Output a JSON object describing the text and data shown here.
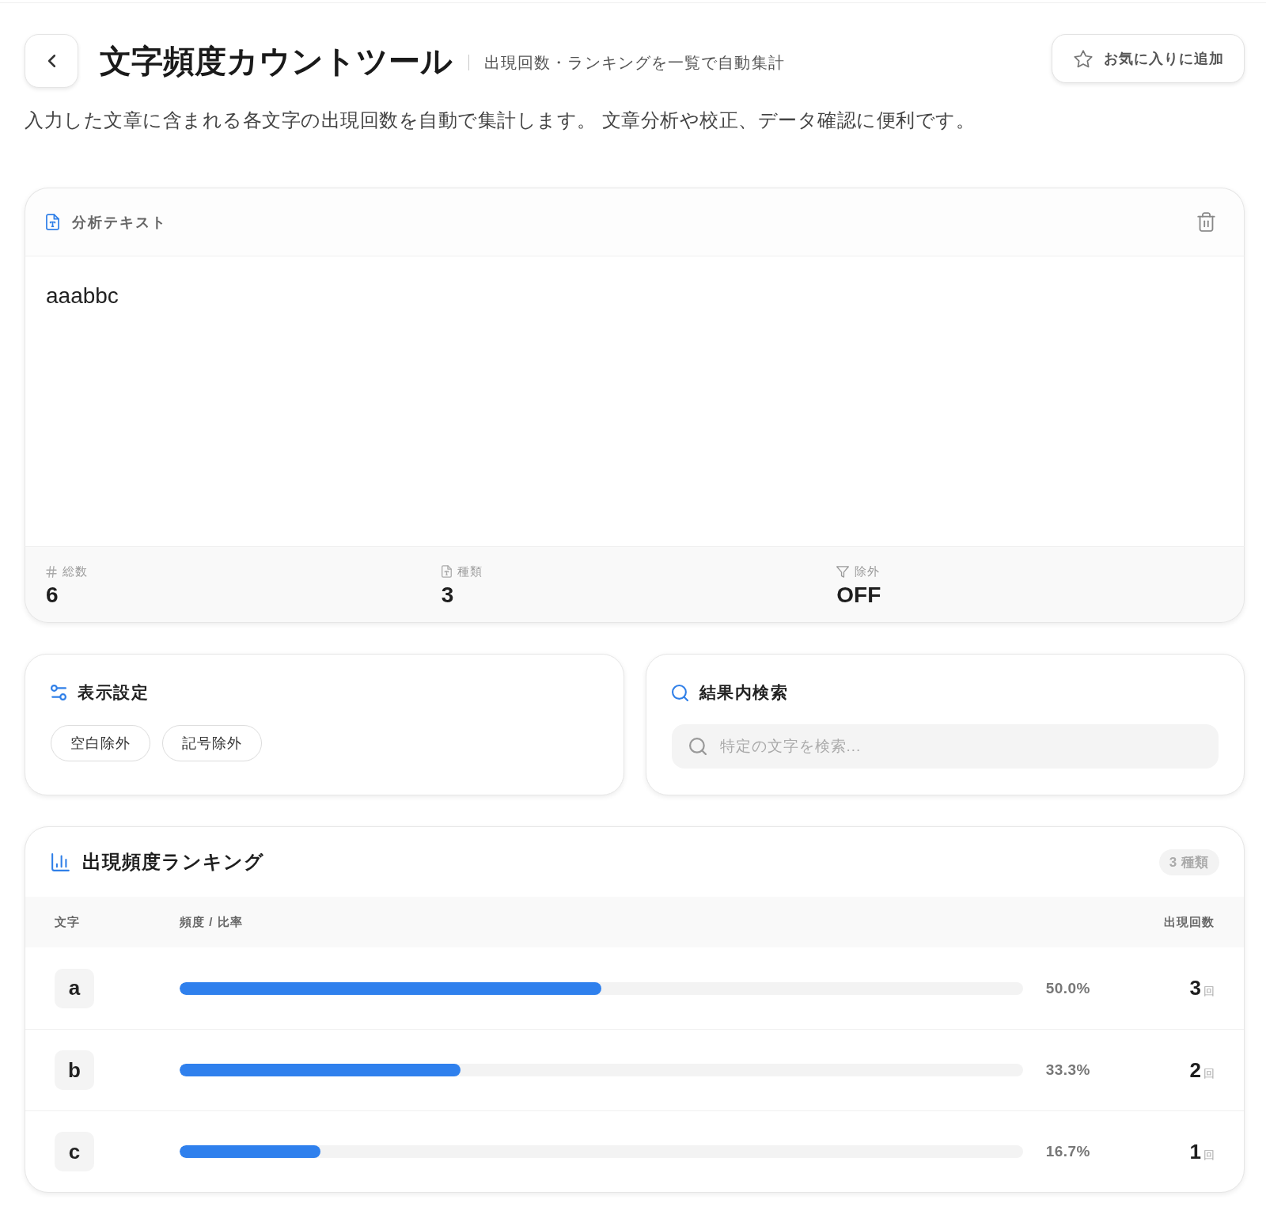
{
  "header": {
    "title": "文字頻度カウントツール",
    "subtitle": "出現回数・ランキングを一覧で自動集計",
    "favorite_button": "お気に入りに追加"
  },
  "description": "入力した文章に含まれる各文字の出現回数を自動で集計します。 文章分析や校正、データ確認に便利です。",
  "input_card": {
    "title": "分析テキスト",
    "value": "aaabbc",
    "stats": [
      {
        "kind": "total",
        "label": "総数",
        "value": "6"
      },
      {
        "kind": "types",
        "label": "種類",
        "value": "3"
      },
      {
        "kind": "exclude",
        "label": "除外",
        "value": "OFF"
      }
    ]
  },
  "settings": {
    "title": "表示設定",
    "toggles": [
      {
        "label": "空白除外",
        "on": false
      },
      {
        "label": "記号除外",
        "on": false
      }
    ]
  },
  "search": {
    "title": "結果内検索",
    "placeholder": "特定の文字を検索..."
  },
  "ranking": {
    "title": "出現頻度ランキング",
    "badge": "3 種類",
    "columns": [
      "文字",
      "頻度 / 比率",
      "出現回数"
    ],
    "rows": [
      {
        "char": "a",
        "level": 0.5,
        "percent": "50.0%",
        "count": "3",
        "unit": "回"
      },
      {
        "char": "b",
        "level": 0.333,
        "percent": "33.3%",
        "count": "2",
        "unit": "回"
      },
      {
        "char": "c",
        "level": 0.167,
        "percent": "16.7%",
        "count": "1",
        "unit": "回"
      }
    ]
  }
}
